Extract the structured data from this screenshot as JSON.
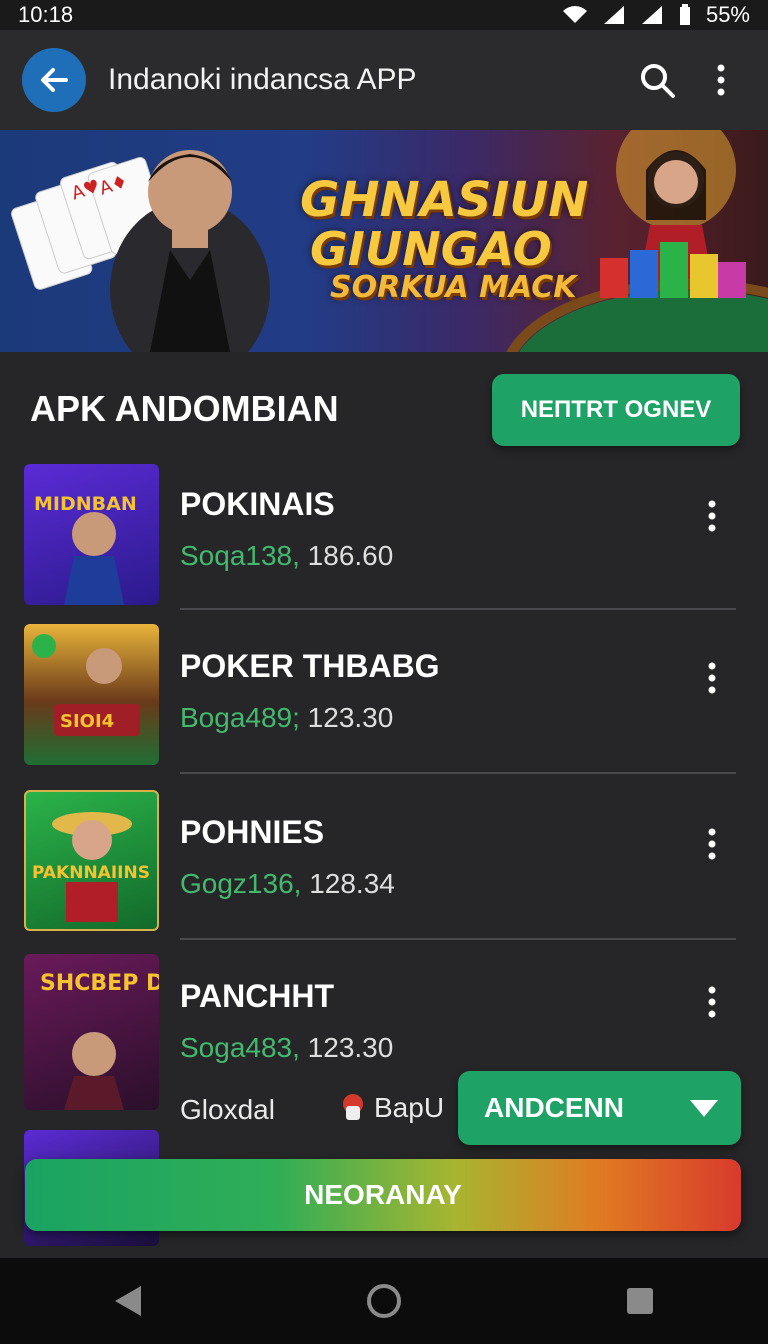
{
  "status_bar": {
    "time": "10:18",
    "battery": "55%"
  },
  "app_bar": {
    "title": "Indanokі indancsa APP",
    "back_icon": "arrow-left-icon",
    "search_icon": "search-icon",
    "menu_icon": "more-vertical-icon"
  },
  "banner": {
    "line1": "GHNASIUN",
    "line2": "GIUNGAO",
    "line3": "SORKUA MACK"
  },
  "section": {
    "title": "APK ANDOMBIAN",
    "button_label": "NEПTRT OGNEV"
  },
  "games": [
    {
      "name": "POKINAIS",
      "code": "Soqa138,",
      "value": "186.60",
      "thumb_text": "MIDNBAN"
    },
    {
      "name": "POKER THBABG",
      "code": "Boga489;",
      "value": "123.30",
      "thumb_text": "SIOI4"
    },
    {
      "name": "POHNIES",
      "code": "Gogz136,",
      "value": "128.34",
      "thumb_text": "PAKNNAIINS"
    },
    {
      "name": "PANCHHT",
      "code": "Soga483,",
      "value": "123.30",
      "thumb_text": "SHCBEP DANKEA"
    }
  ],
  "footer_row": {
    "left_label": "Gloxdal",
    "pin_label": "BapU",
    "dropdown_value": "ANDCENN"
  },
  "cta": {
    "label": "NEORANAY"
  },
  "colors": {
    "accent_green": "#1fa266",
    "back_blue": "#1f6fb8",
    "code_green": "#43b96e"
  }
}
